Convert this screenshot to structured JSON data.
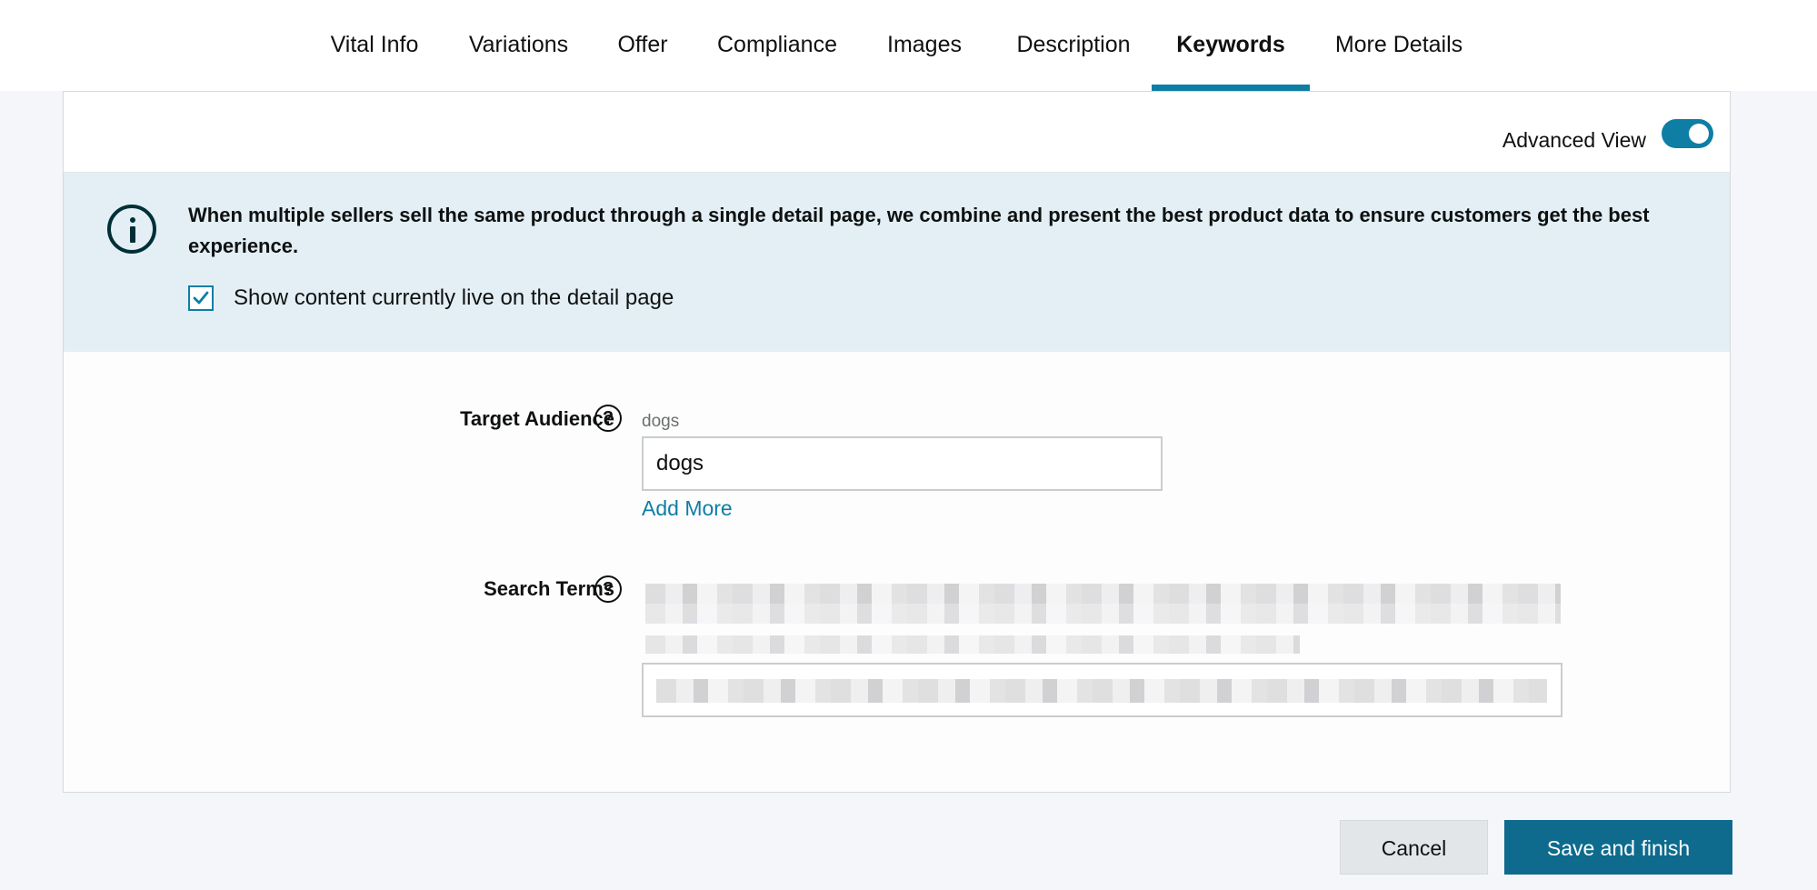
{
  "tabs": [
    {
      "label": "Vital Info"
    },
    {
      "label": "Variations"
    },
    {
      "label": "Offer"
    },
    {
      "label": "Compliance"
    },
    {
      "label": "Images"
    },
    {
      "label": "Description"
    },
    {
      "label": "Keywords",
      "active": true
    },
    {
      "label": "More Details"
    }
  ],
  "advanced_view": {
    "label": "Advanced View",
    "enabled": true
  },
  "notice": {
    "text": "When multiple sellers sell the same product through a single detail page, we combine and present the best product data to ensure customers get the best experience.",
    "checkbox_label": "Show content currently live on the detail page",
    "checkbox_checked": true
  },
  "fields": {
    "target_audience": {
      "label": "Target Audience",
      "live_value": "dogs",
      "input_value": "dogs",
      "add_more": "Add More"
    },
    "search_terms": {
      "label": "Search Terms",
      "redacted": true
    }
  },
  "buttons": {
    "cancel": "Cancel",
    "save": "Save and finish"
  },
  "colors": {
    "accent": "#0e7ea5",
    "primary_button": "#0e6b8d",
    "notice_bg": "#e3eff5"
  }
}
